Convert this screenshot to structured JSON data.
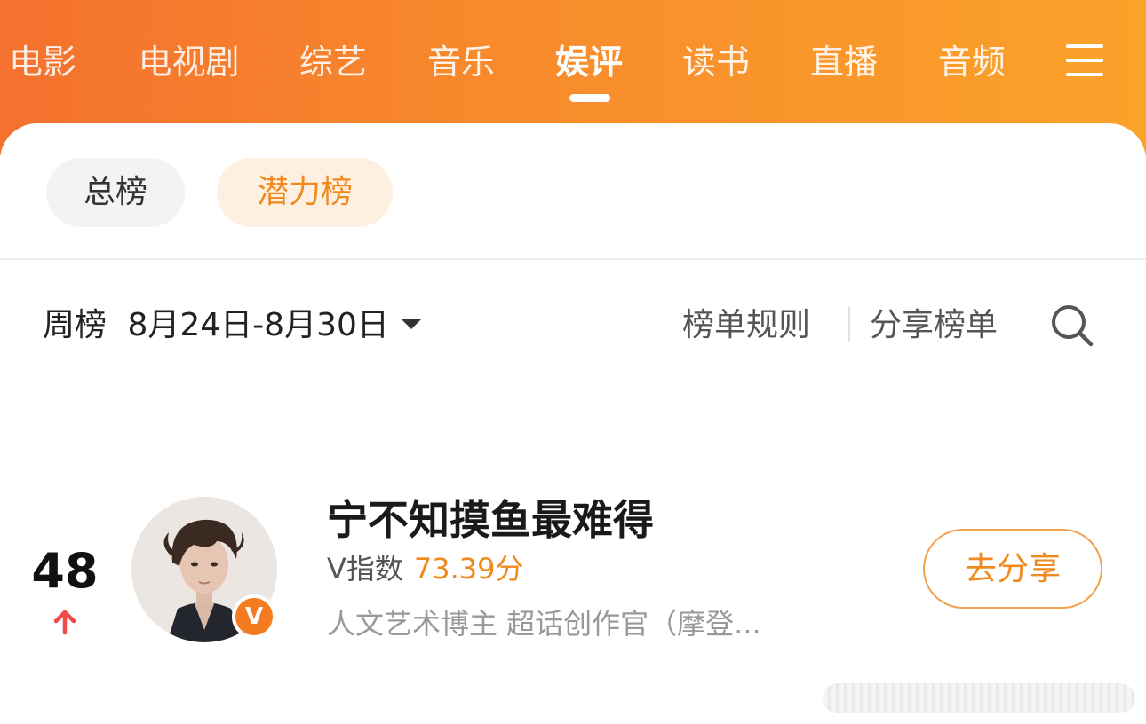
{
  "nav": {
    "tabs": [
      {
        "label": "电影"
      },
      {
        "label": "电视剧"
      },
      {
        "label": "综艺"
      },
      {
        "label": "音乐"
      },
      {
        "label": "娱评"
      },
      {
        "label": "读书"
      },
      {
        "label": "直播"
      },
      {
        "label": "音频"
      }
    ],
    "active_tab": "娱评",
    "menu_icon": "hamburger-menu-icon"
  },
  "board_tabs": {
    "total": "总榜",
    "potential": "潜力榜",
    "active": "潜力榜"
  },
  "period": {
    "label": "周榜",
    "range": "8月24日-8月30日"
  },
  "actions": {
    "rules": "榜单规则",
    "share_list": "分享榜单",
    "search_icon": "search-icon"
  },
  "entry": {
    "rank": "48",
    "trend": "up",
    "name": "宁不知摸鱼最难得",
    "vindex_label": "V指数",
    "vindex_value": "73.39分",
    "description": "人文艺术博主 超话创作官（摩登...",
    "verified_badge": "V",
    "share_button": "去分享"
  },
  "colors": {
    "header_start": "#f4712e",
    "header_end": "#fba22a",
    "accent": "#f08a1f",
    "rank_up": "#f04a4a"
  }
}
